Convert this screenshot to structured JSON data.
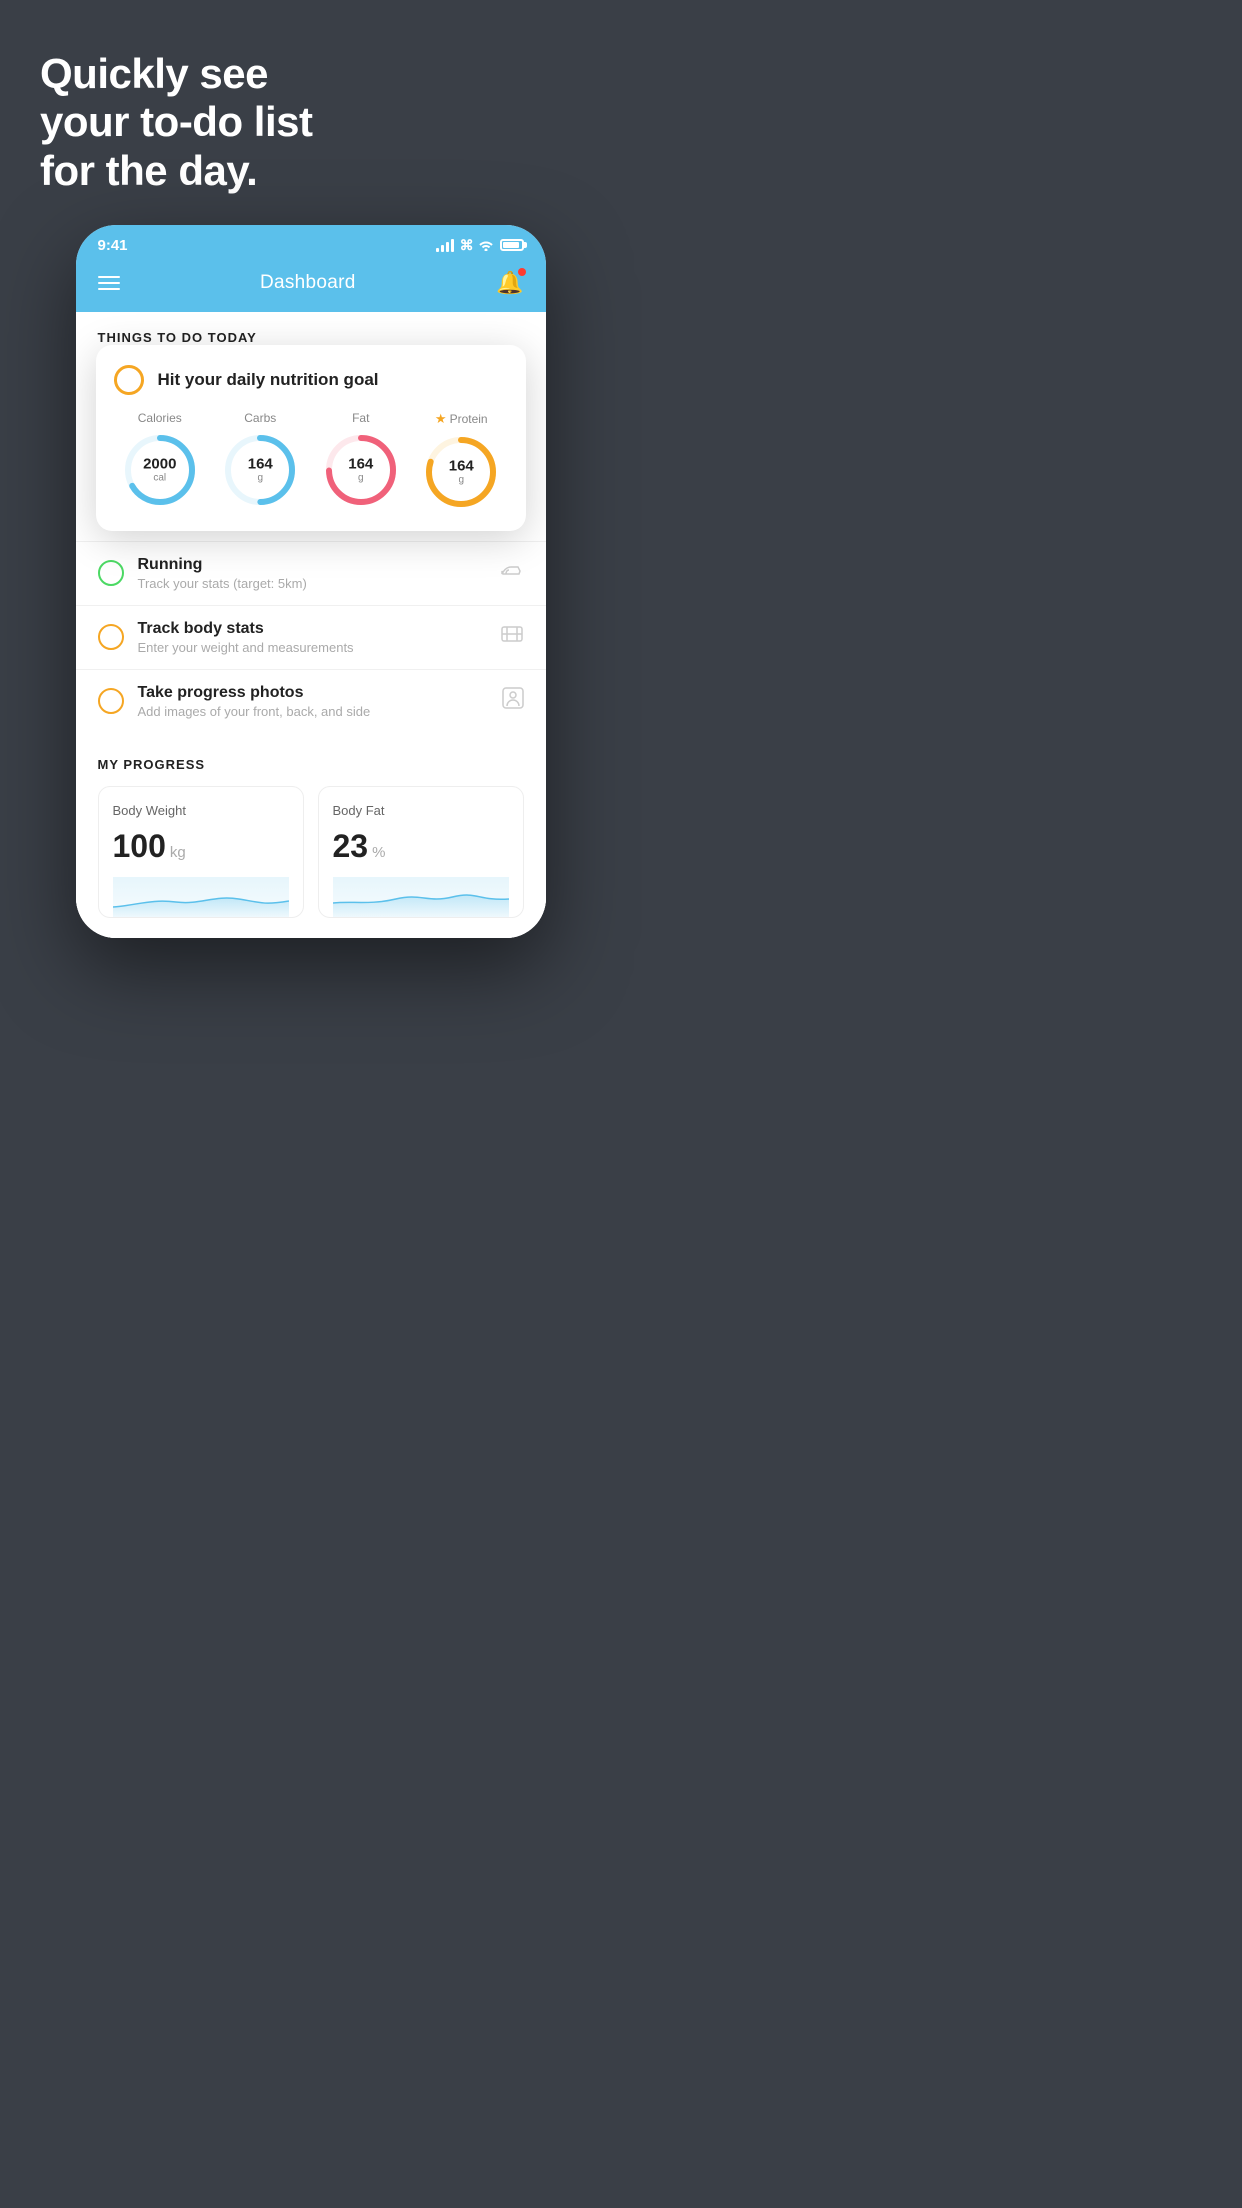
{
  "background_color": "#3a3f47",
  "hero": {
    "line1": "Quickly see",
    "line2": "your to-do list",
    "line3": "for the day."
  },
  "status_bar": {
    "time": "9:41"
  },
  "nav": {
    "title": "Dashboard"
  },
  "things_to_do": {
    "section_label": "THINGS TO DO TODAY"
  },
  "nutrition_card": {
    "title": "Hit your daily nutrition goal",
    "items": [
      {
        "label": "Calories",
        "value": "2000",
        "unit": "cal",
        "color": "#5bc0eb",
        "bg_color": "#e8f6fc",
        "progress": 0.65,
        "starred": false
      },
      {
        "label": "Carbs",
        "value": "164",
        "unit": "g",
        "color": "#5bc0eb",
        "bg_color": "#e8f6fc",
        "progress": 0.5,
        "starred": false
      },
      {
        "label": "Fat",
        "value": "164",
        "unit": "g",
        "color": "#f0617a",
        "bg_color": "#fde8ec",
        "progress": 0.75,
        "starred": false
      },
      {
        "label": "Protein",
        "value": "164",
        "unit": "g",
        "color": "#f5a623",
        "bg_color": "#fef4e0",
        "progress": 0.8,
        "starred": true
      }
    ]
  },
  "tasks": [
    {
      "name": "Running",
      "sub": "Track your stats (target: 5km)",
      "circle_color": "green",
      "icon": "shoe"
    },
    {
      "name": "Track body stats",
      "sub": "Enter your weight and measurements",
      "circle_color": "yellow",
      "icon": "scale"
    },
    {
      "name": "Take progress photos",
      "sub": "Add images of your front, back, and side",
      "circle_color": "yellow",
      "icon": "person"
    }
  ],
  "progress": {
    "section_label": "MY PROGRESS",
    "cards": [
      {
        "title": "Body Weight",
        "value": "100",
        "unit": "kg"
      },
      {
        "title": "Body Fat",
        "value": "23",
        "unit": "%"
      }
    ]
  }
}
